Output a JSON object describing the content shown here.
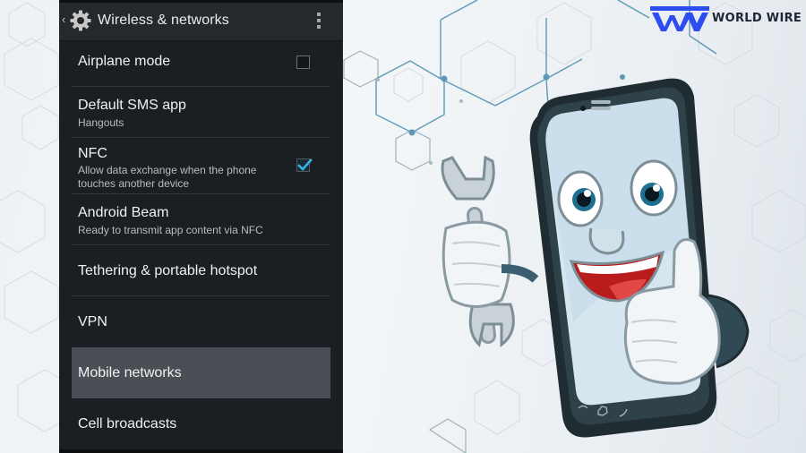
{
  "background": {
    "style": "hexagon-network",
    "accent_color": "#4b8fb0"
  },
  "android_settings": {
    "action_bar": {
      "back_icon": "chevron-left-icon",
      "app_icon": "gear-icon",
      "title": "Wireless & networks",
      "overflow_icon": "overflow-menu-icon"
    },
    "items": [
      {
        "id": "airplane-mode",
        "title": "Airplane mode",
        "subtitle": null,
        "control": "checkbox",
        "checked": false
      },
      {
        "id": "default-sms-app",
        "title": "Default SMS app",
        "subtitle": "Hangouts"
      },
      {
        "id": "nfc",
        "title": "NFC",
        "subtitle_line1": "Allow data exchange when the phone",
        "subtitle_line2": "touches another device",
        "control": "checkbox",
        "checked": true
      },
      {
        "id": "android-beam",
        "title": "Android Beam",
        "subtitle": "Ready to transmit app content via NFC"
      },
      {
        "id": "tethering",
        "title": "Tethering & portable hotspot",
        "subtitle": null
      },
      {
        "id": "vpn",
        "title": "VPN",
        "subtitle": null
      },
      {
        "id": "mobile-networks",
        "title": "Mobile networks",
        "subtitle": null,
        "selected": true
      },
      {
        "id": "cell-broadcasts",
        "title": "Cell broadcasts",
        "subtitle": null
      }
    ],
    "colors": {
      "panel_bg": "#1b1e22",
      "action_bar_bg": "#25282c",
      "selected_row_bg": "#4b4f55",
      "checkbox_accent": "#33b5e5"
    }
  },
  "logo": {
    "mark": "WW",
    "text": "WORLD WIRE",
    "mark_color": "#2d4df0",
    "text_color": "#1f2535"
  },
  "illustration": {
    "subject": "cartoon smartphone mascot holding a wrench and giving a thumbs up",
    "icons": [
      "wrench-icon",
      "thumbs-up-icon",
      "phone-mascot-icon"
    ]
  }
}
